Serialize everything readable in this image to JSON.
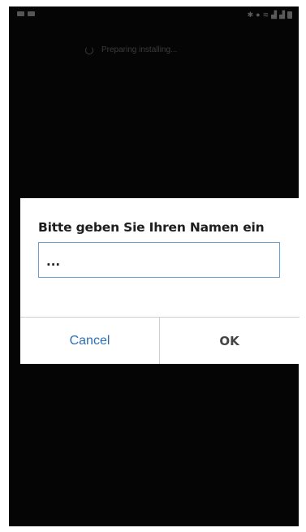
{
  "loading": {
    "text": "Preparing installing..."
  },
  "dialog": {
    "title": "Bitte geben Sie Ihren Namen ein",
    "input_value": "...",
    "cancel_label": "Cancel",
    "ok_label": "OK"
  },
  "colors": {
    "screen_background": "#050505",
    "dialog_background": "#ffffff",
    "input_border": "#6aa0cf",
    "cancel_text": "#2a6fb5",
    "ok_text": "#444444"
  }
}
